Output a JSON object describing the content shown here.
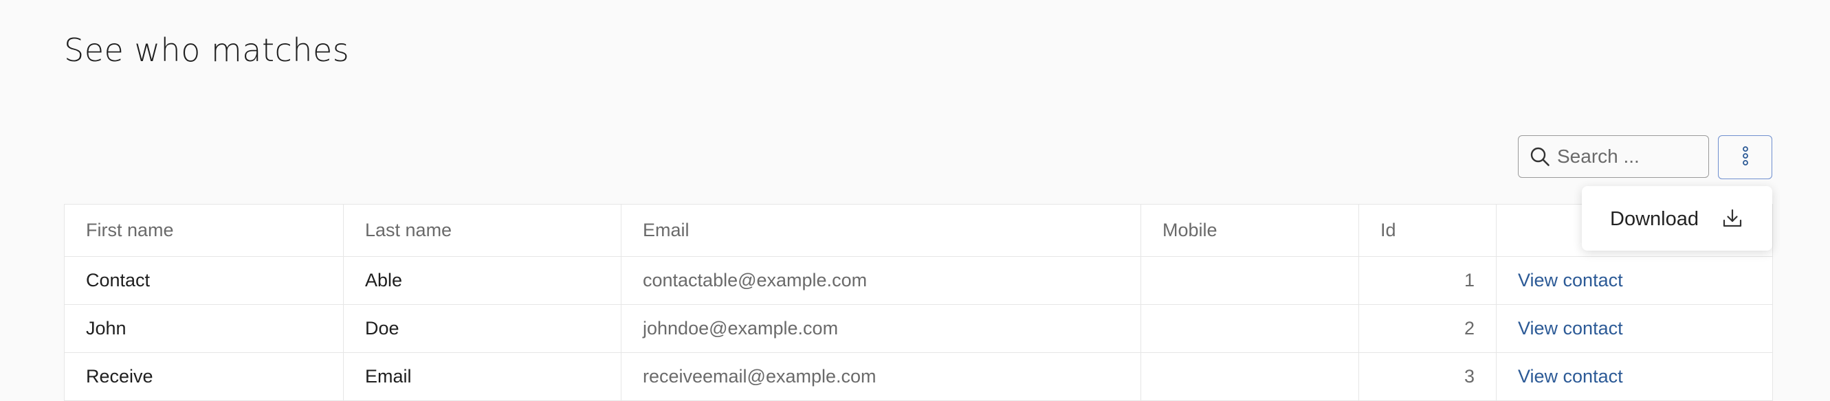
{
  "page": {
    "title": "See who matches"
  },
  "search": {
    "placeholder": "Search ...",
    "value": ""
  },
  "more_menu": {
    "icon": "vertical-ellipsis-icon",
    "items": [
      {
        "label": "Download",
        "icon": "download-icon"
      }
    ]
  },
  "table": {
    "columns": [
      "First name",
      "Last name",
      "Email",
      "Mobile",
      "Id",
      ""
    ],
    "rows": [
      {
        "first_name": "Contact",
        "last_name": "Able",
        "email": "contactable@example.com",
        "mobile": "",
        "id": "1",
        "action": "View contact"
      },
      {
        "first_name": "John",
        "last_name": "Doe",
        "email": "johndoe@example.com",
        "mobile": "",
        "id": "2",
        "action": "View contact"
      },
      {
        "first_name": "Receive",
        "last_name": "Email",
        "email": "receiveemail@example.com",
        "mobile": "",
        "id": "3",
        "action": "View contact"
      }
    ]
  },
  "colors": {
    "background": "#fafafa",
    "link": "#2c5a96",
    "button_border": "#6f8fcf",
    "muted_text": "#6a6a6a"
  }
}
